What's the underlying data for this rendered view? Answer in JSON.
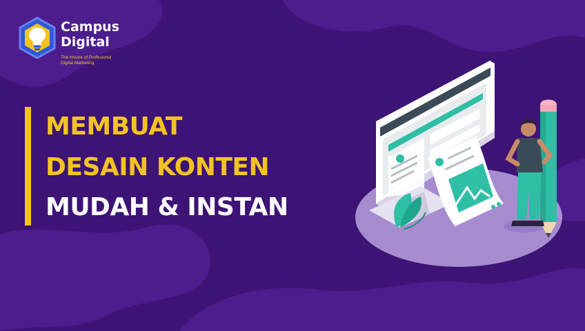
{
  "colors": {
    "background": "#3d1375",
    "blob": "#4c1d8c",
    "accent_yellow": "#f3c421",
    "teal": "#2ebfa5",
    "logo_blue": "#2d5bd6"
  },
  "logo": {
    "name_line_1": "Campus",
    "name_line_2": "Digital",
    "tagline_line_1": "The House of Profesional",
    "tagline_line_2": "Digital Marketing",
    "icon": "lightbulb-hexagon-icon"
  },
  "headline": {
    "line_1": "MEMBUAT",
    "line_2": "DESAIN KONTEN",
    "line_3": "MUDAH & INSTAN"
  }
}
